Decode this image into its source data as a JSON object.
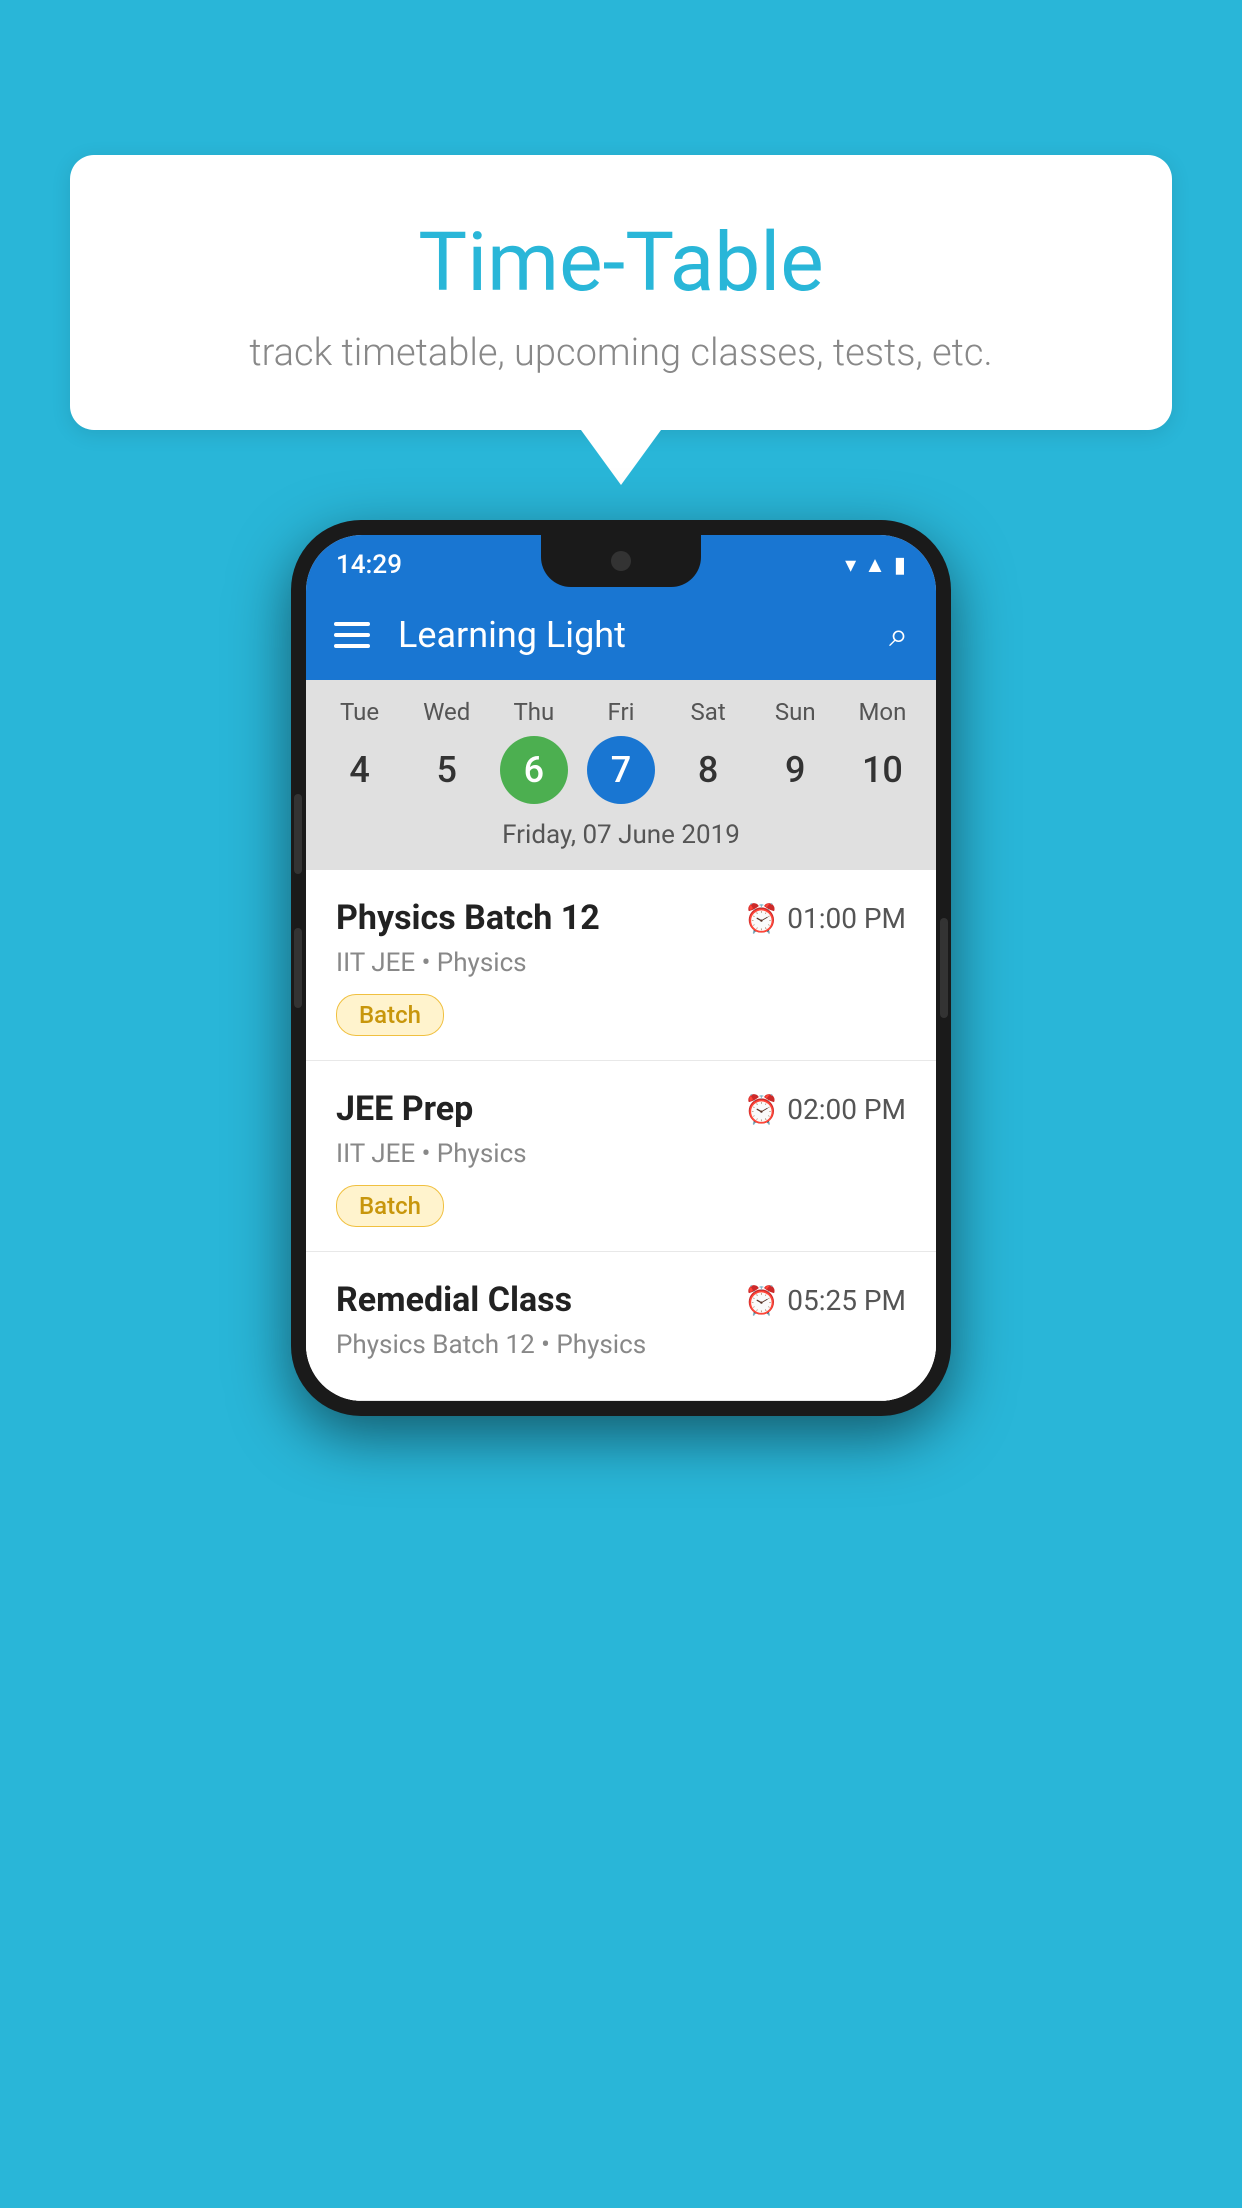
{
  "background_color": "#29B6D8",
  "speech_bubble": {
    "title": "Time-Table",
    "subtitle": "track timetable, upcoming classes, tests, etc."
  },
  "phone": {
    "status_bar": {
      "time": "14:29"
    },
    "app_bar": {
      "title": "Learning Light"
    },
    "calendar": {
      "days": [
        {
          "name": "Tue",
          "number": "4",
          "state": "normal"
        },
        {
          "name": "Wed",
          "number": "5",
          "state": "normal"
        },
        {
          "name": "Thu",
          "number": "6",
          "state": "today"
        },
        {
          "name": "Fri",
          "number": "7",
          "state": "selected"
        },
        {
          "name": "Sat",
          "number": "8",
          "state": "normal"
        },
        {
          "name": "Sun",
          "number": "9",
          "state": "normal"
        },
        {
          "name": "Mon",
          "number": "10",
          "state": "normal"
        }
      ],
      "selected_date_label": "Friday, 07 June 2019"
    },
    "schedule_items": [
      {
        "title": "Physics Batch 12",
        "time": "01:00 PM",
        "meta": "IIT JEE • Physics",
        "badge": "Batch"
      },
      {
        "title": "JEE Prep",
        "time": "02:00 PM",
        "meta": "IIT JEE • Physics",
        "badge": "Batch"
      },
      {
        "title": "Remedial Class",
        "time": "05:25 PM",
        "meta": "Physics Batch 12 • Physics",
        "badge": null
      }
    ]
  }
}
